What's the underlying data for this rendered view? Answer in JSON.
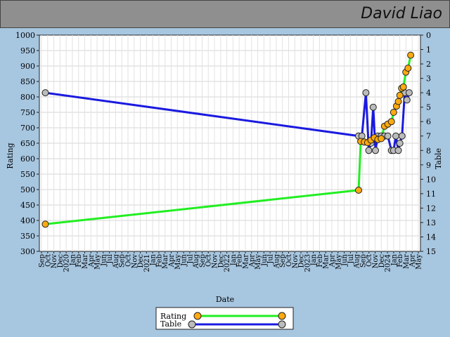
{
  "header": {
    "player_name": "David Liao"
  },
  "colors": {
    "rating_line": "#22ee22",
    "table_line": "#1a1ae0",
    "rating_marker": "#ffaa11",
    "table_marker": "#bbbbbb"
  },
  "chart_data": {
    "type": "line",
    "xlabel": "Date",
    "ylabel_left": "Rating",
    "ylabel_right": "Table",
    "ylim_left": [
      300,
      1000
    ],
    "ylim_right": [
      15,
      0
    ],
    "grid": true,
    "legend_position": "bottom-center",
    "x_tick_labels": [
      "Sep",
      "Oct",
      "Nov",
      "Dec",
      "2020",
      "Jan",
      "Feb",
      "Mar",
      "Apr",
      "May",
      "Jun",
      "Jul",
      "Aug",
      "Sep",
      "Oct",
      "Nov",
      "Dec",
      "2021",
      "Jan",
      "Feb",
      "Mar",
      "Apr",
      "May",
      "Jun",
      "Jul",
      "Aug",
      "Sep",
      "Oct",
      "Nov",
      "Dec",
      "2022",
      "Jan",
      "Feb",
      "Mar",
      "Apr",
      "May",
      "Jun",
      "Jul",
      "Aug",
      "Sep",
      "Oct",
      "Nov",
      "Dec",
      "2023",
      "Jan",
      "Feb",
      "Mar",
      "Apr",
      "May",
      "Jun",
      "Jul",
      "Aug",
      "Sep",
      "Oct",
      "Nov",
      "Dec",
      "2024",
      "Jan",
      "Feb",
      "Mar",
      "Apr",
      "May"
    ],
    "y_ticks_left": [
      300,
      350,
      400,
      450,
      500,
      550,
      600,
      650,
      700,
      750,
      800,
      850,
      900,
      950,
      1000
    ],
    "y_ticks_right": [
      0,
      1,
      2,
      3,
      4,
      5,
      6,
      7,
      8,
      9,
      10,
      11,
      12,
      13,
      14,
      15
    ],
    "series": [
      {
        "name": "Rating",
        "axis": "left",
        "points": [
          [
            "2019-09-28",
            388
          ],
          [
            "2023-08-10",
            498
          ],
          [
            "2023-08-20",
            656
          ],
          [
            "2023-09-05",
            654
          ],
          [
            "2023-09-20",
            652
          ],
          [
            "2023-10-05",
            660
          ],
          [
            "2023-10-20",
            668
          ],
          [
            "2023-11-05",
            662
          ],
          [
            "2023-11-20",
            665
          ],
          [
            "2023-12-05",
            705
          ],
          [
            "2023-12-20",
            712
          ],
          [
            "2024-01-05",
            720
          ],
          [
            "2024-01-15",
            750
          ],
          [
            "2024-01-28",
            770
          ],
          [
            "2024-02-05",
            785
          ],
          [
            "2024-02-12",
            805
          ],
          [
            "2024-02-20",
            828
          ],
          [
            "2024-02-28",
            832
          ],
          [
            "2024-03-10",
            880
          ],
          [
            "2024-03-20",
            893
          ],
          [
            "2024-04-01",
            935
          ]
        ]
      },
      {
        "name": "Table",
        "axis": "right",
        "points": [
          [
            "2019-09-28",
            4
          ],
          [
            "2023-08-10",
            7
          ],
          [
            "2023-08-25",
            7
          ],
          [
            "2023-09-12",
            4
          ],
          [
            "2023-09-25",
            8
          ],
          [
            "2023-10-05",
            7.5
          ],
          [
            "2023-10-15",
            5
          ],
          [
            "2023-10-25",
            8
          ],
          [
            "2023-11-05",
            7
          ],
          [
            "2023-11-20",
            7
          ],
          [
            "2023-12-05",
            7
          ],
          [
            "2023-12-20",
            7
          ],
          [
            "2024-01-05",
            8
          ],
          [
            "2024-01-15",
            8
          ],
          [
            "2024-01-25",
            7
          ],
          [
            "2024-02-05",
            8
          ],
          [
            "2024-02-12",
            7.5
          ],
          [
            "2024-02-22",
            7
          ],
          [
            "2024-03-05",
            4
          ],
          [
            "2024-03-15",
            4.5
          ],
          [
            "2024-03-25",
            4
          ]
        ]
      }
    ]
  }
}
